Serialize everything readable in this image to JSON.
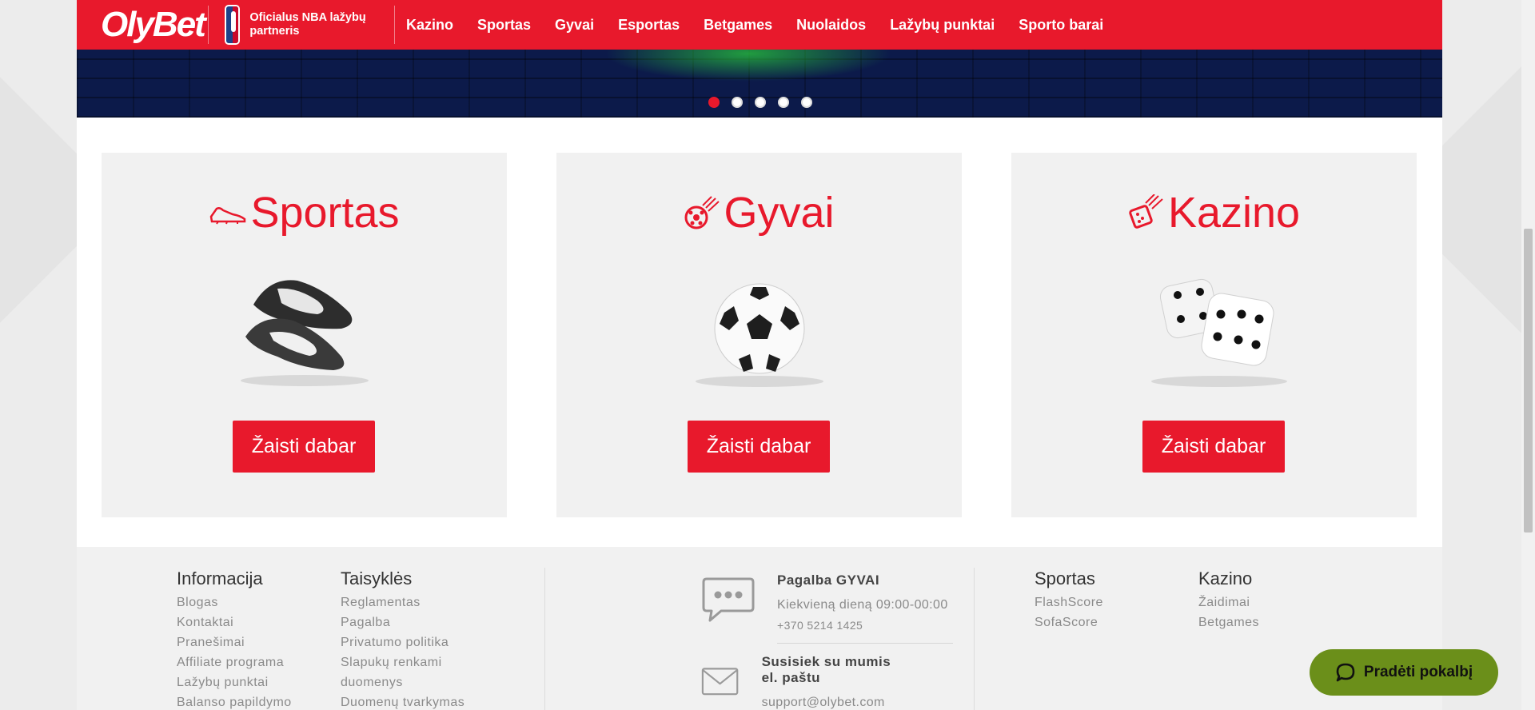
{
  "header": {
    "logo": "OlyBet",
    "nba_partner": "Oficialus NBA lažybų partneris",
    "nav": [
      "Kazino",
      "Sportas",
      "Gyvai",
      "Esportas",
      "Betgames",
      "Nuolaidos",
      "Lažybų punktai",
      "Sporto barai"
    ]
  },
  "banner": {
    "slide_count": 5,
    "active_slide": 1
  },
  "cards": [
    {
      "title": "Sportas",
      "icon": "football-boot-icon",
      "image": "football-boots",
      "button": "Žaisti dabar"
    },
    {
      "title": "Gyvai",
      "icon": "flying-ball-icon",
      "image": "soccer-ball",
      "button": "Žaisti dabar"
    },
    {
      "title": "Kazino",
      "icon": "flying-dice-icon",
      "image": "dice",
      "button": "Žaisti dabar"
    }
  ],
  "footer": {
    "informacija": {
      "title": "Informacija",
      "links": [
        "Blogas",
        "Kontaktai",
        "Pranešimai",
        "Affiliate programa",
        "Lažybų punktai",
        "Balanso papildymo"
      ]
    },
    "taisykles": {
      "title": "Taisyklės",
      "links": [
        "Reglamentas",
        "Pagalba",
        "Privatumo politika",
        "Slapukų renkami",
        "duomenys",
        "Duomenų tvarkymas"
      ]
    },
    "support": {
      "live_title": "Pagalba GYVAI",
      "live_hours": "Kiekvieną dieną 09:00-00:00",
      "live_phone": "+370 5214 1425",
      "email_title": "Susisiek su mumis el. paštu",
      "email": "support@olybet.com"
    },
    "sportas": {
      "title": "Sportas",
      "links": [
        "FlashScore",
        "SofaScore"
      ]
    },
    "kazino": {
      "title": "Kazino",
      "links": [
        "Žaidimai",
        "Betgames"
      ]
    }
  },
  "chat": {
    "label": "Pradėti pokalbį"
  },
  "colors": {
    "brand": "#e8192c",
    "chat": "#6b8f1a"
  }
}
